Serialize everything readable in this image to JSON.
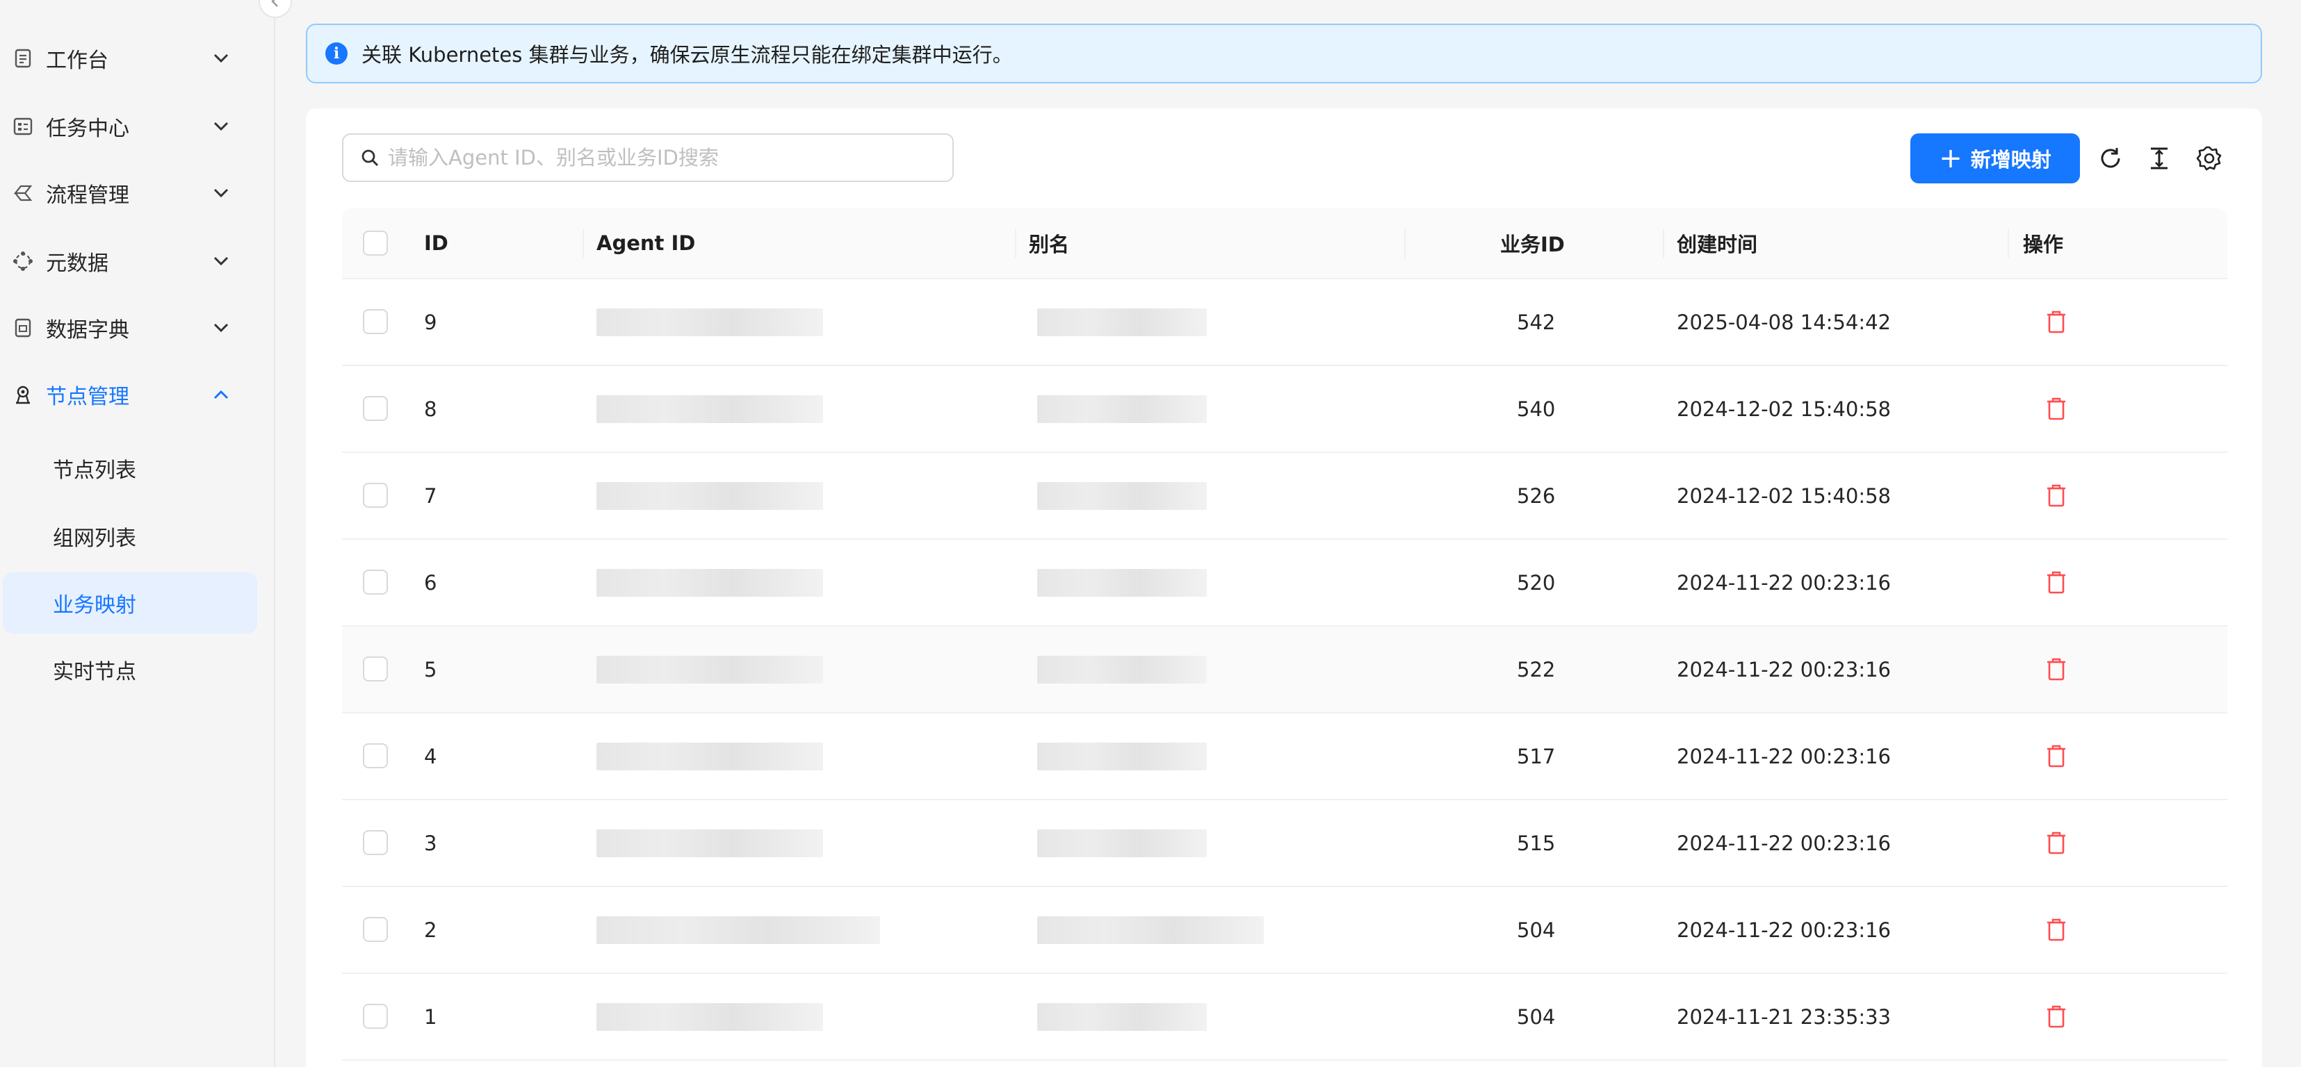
{
  "sidebar": {
    "menu": [
      {
        "label": "工作台",
        "icon": "document-icon",
        "expanded": false
      },
      {
        "label": "任务中心",
        "icon": "task-icon",
        "expanded": false
      },
      {
        "label": "流程管理",
        "icon": "workflow-icon",
        "expanded": false
      },
      {
        "label": "元数据",
        "icon": "metadata-icon",
        "expanded": false
      },
      {
        "label": "数据字典",
        "icon": "dictionary-icon",
        "expanded": false
      },
      {
        "label": "节点管理",
        "icon": "node-icon",
        "expanded": true,
        "active": true
      }
    ],
    "submenu": [
      {
        "label": "节点列表",
        "selected": false
      },
      {
        "label": "组网列表",
        "selected": false
      },
      {
        "label": "业务映射",
        "selected": true
      },
      {
        "label": "实时节点",
        "selected": false
      }
    ]
  },
  "alert": {
    "text": "关联 Kubernetes 集群与业务，确保云原生流程只能在绑定集群中运行。",
    "icon": "info-icon"
  },
  "toolbar": {
    "search_placeholder": "请输入Agent ID、别名或业务ID搜索",
    "add_label": "新增映射",
    "icons": [
      "refresh-icon",
      "column-height-icon",
      "settings-icon"
    ]
  },
  "table": {
    "columns": [
      "ID",
      "Agent ID",
      "别名",
      "业务ID",
      "创建时间",
      "操作"
    ],
    "rows": [
      {
        "id": "9",
        "business_id": "542",
        "created": "2025-04-08 14:54:42"
      },
      {
        "id": "8",
        "business_id": "540",
        "created": "2024-12-02 15:40:58"
      },
      {
        "id": "7",
        "business_id": "526",
        "created": "2024-12-02 15:40:58"
      },
      {
        "id": "6",
        "business_id": "520",
        "created": "2024-11-22 00:23:16"
      },
      {
        "id": "5",
        "business_id": "522",
        "created": "2024-11-22 00:23:16"
      },
      {
        "id": "4",
        "business_id": "517",
        "created": "2024-11-22 00:23:16"
      },
      {
        "id": "3",
        "business_id": "515",
        "created": "2024-11-22 00:23:16"
      },
      {
        "id": "2",
        "business_id": "504",
        "created": "2024-11-22 00:23:16"
      },
      {
        "id": "1",
        "business_id": "504",
        "created": "2024-11-21 23:35:33"
      }
    ]
  },
  "colors": {
    "primary": "#1677ff",
    "danger": "#ff4d4f",
    "alert_bg": "#e6f4ff",
    "alert_border": "#91caff"
  }
}
